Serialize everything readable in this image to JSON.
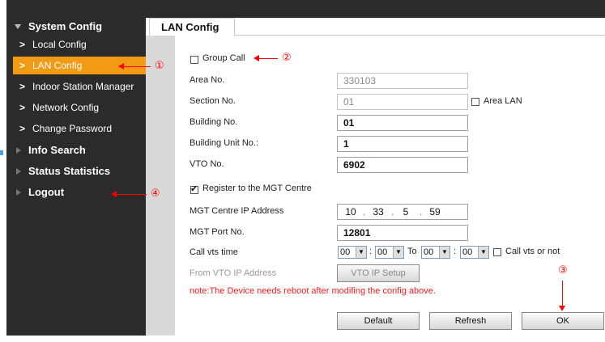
{
  "sidebar": {
    "sections": [
      {
        "label": "System Config"
      },
      {
        "label": "Info Search"
      },
      {
        "label": "Status Statistics"
      },
      {
        "label": "Logout"
      }
    ],
    "items": [
      {
        "label": "Local Config"
      },
      {
        "label": "LAN Config"
      },
      {
        "label": "Indoor Station Manager"
      },
      {
        "label": "Network Config"
      },
      {
        "label": "Change Password"
      }
    ]
  },
  "tab": {
    "label": "LAN Config"
  },
  "form": {
    "group_call": {
      "label": "Group Call",
      "checked": false
    },
    "area_no": {
      "label": "Area No.",
      "value": "330103"
    },
    "section_no": {
      "label": "Section No.",
      "value": "01"
    },
    "area_lan": {
      "label": "Area LAN",
      "checked": false
    },
    "building_no": {
      "label": "Building No.",
      "value": "01"
    },
    "building_unit_no": {
      "label": "Building Unit No.:",
      "value": "1"
    },
    "vto_no": {
      "label": "VTO No.",
      "value": "6902"
    },
    "register_mgt": {
      "label": "Register to the MGT Centre",
      "checked": true
    },
    "mgt_ip": {
      "label": "MGT Centre IP Address",
      "octets": [
        "10",
        "33",
        "5",
        "59"
      ]
    },
    "mgt_port": {
      "label": "MGT Port No.",
      "value": "12801"
    },
    "call_vts_time": {
      "label": "Call vts time",
      "from_hour": "00",
      "from_min": "00",
      "to_label": "To",
      "to_hour": "00",
      "to_min": "00",
      "colon": ":"
    },
    "call_vts_or_not": {
      "label": "Call vts or not",
      "checked": false
    },
    "from_vto_ip": {
      "label": "From VTO IP Address",
      "button": "VTO IP Setup"
    },
    "note": "note:The Device needs reboot after modifing the config above."
  },
  "buttons": {
    "default": "Default",
    "refresh": "Refresh",
    "ok": "OK"
  },
  "annotations": {
    "n1": "①",
    "n2": "②",
    "n3": "③",
    "n4": "④"
  },
  "colors": {
    "sidebar_bg": "#2b2b2b",
    "active_item": "#f39a14",
    "note_text": "#ff1a1a",
    "annotation": "#ff0000"
  }
}
